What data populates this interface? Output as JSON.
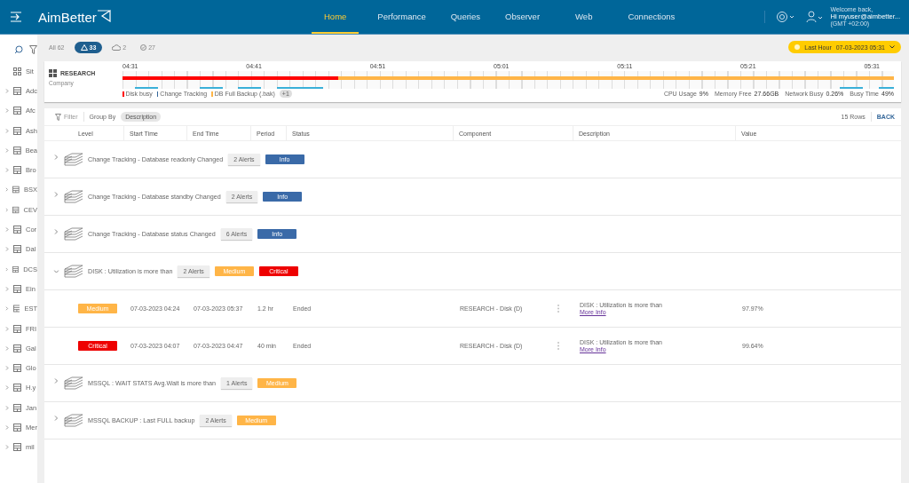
{
  "header": {
    "brand": "AimBetter",
    "nav": [
      {
        "label": "Home",
        "selected": true
      },
      {
        "label": "Performance",
        "selected": false
      },
      {
        "label": "Queries",
        "selected": false
      },
      {
        "label": "Observer",
        "selected": false
      },
      {
        "label": "Web",
        "selected": false
      },
      {
        "label": "Connections",
        "selected": false
      }
    ],
    "user": {
      "greeting": "Welcome back,",
      "name": "Hi myuser@aimbetter...",
      "timezone": "(GMT +02:00)"
    }
  },
  "sidebar": {
    "items": [
      {
        "label": "Sit",
        "kind": "group"
      },
      {
        "label": "Adc",
        "kind": "server"
      },
      {
        "label": "Afc",
        "kind": "server"
      },
      {
        "label": "Ash",
        "kind": "server"
      },
      {
        "label": "Bea",
        "kind": "server"
      },
      {
        "label": "Bro",
        "kind": "server"
      },
      {
        "label": "BSX",
        "kind": "server"
      },
      {
        "label": "CEV",
        "kind": "server"
      },
      {
        "label": "Cor",
        "kind": "server"
      },
      {
        "label": "Dal",
        "kind": "server"
      },
      {
        "label": "DCS",
        "kind": "server"
      },
      {
        "label": "Ein",
        "kind": "server"
      },
      {
        "label": "EST",
        "kind": "server"
      },
      {
        "label": "FRI",
        "kind": "server"
      },
      {
        "label": "Gal",
        "kind": "server"
      },
      {
        "label": "Glo",
        "kind": "server"
      },
      {
        "label": "H.y",
        "kind": "server"
      },
      {
        "label": "Jan",
        "kind": "server"
      },
      {
        "label": "Mer",
        "kind": "server"
      },
      {
        "label": "mil",
        "kind": "server"
      }
    ]
  },
  "filters": [
    {
      "label": "All 62",
      "kind": "all",
      "selected": false
    },
    {
      "label": "33",
      "kind": "alert",
      "selected": true
    },
    {
      "label": "2",
      "kind": "cloud",
      "selected": false
    },
    {
      "label": "27",
      "kind": "check",
      "selected": false
    }
  ],
  "time_range": {
    "label": "Last Hour",
    "value": "07-03-2023 05:31"
  },
  "server": {
    "name": "RESEARCH",
    "type": "Company",
    "ticks": [
      "04:31",
      "04:41",
      "04:51",
      "05:01",
      "05:11",
      "05:21",
      "05:31"
    ],
    "legend": [
      {
        "label": "Disk busy",
        "color": "#ff0000"
      },
      {
        "label": "Change Tracking",
        "color": "#336699"
      },
      {
        "label": "DB Full Backup (.bak)",
        "color": "#ffb547"
      }
    ],
    "more": "+1",
    "stats": [
      {
        "label": "CPU Usage",
        "value": "9%"
      },
      {
        "label": "Memory Free",
        "value": "27.66GB"
      },
      {
        "label": "Network Busy",
        "value": "0.26%"
      },
      {
        "label": "Busy Time",
        "value": "49%"
      }
    ]
  },
  "table": {
    "filter": "Filter",
    "group_by": "Group By",
    "group_value": "Description",
    "row_count": "15 Rows",
    "back": "BACK",
    "columns": [
      "Level",
      "Start Time",
      "End Time",
      "Period",
      "Status",
      "Component",
      "Description",
      "Value"
    ],
    "groups": [
      {
        "title": "Change Tracking - Database readonly Changed",
        "alerts": "2 Alerts",
        "expanded": false,
        "badges": [
          {
            "kind": "info",
            "label": "Info"
          }
        ]
      },
      {
        "title": "Change Tracking - Database standby Changed",
        "alerts": "2 Alerts",
        "expanded": false,
        "badges": [
          {
            "kind": "info",
            "label": "Info"
          }
        ]
      },
      {
        "title": "Change Tracking - Database status Changed",
        "alerts": "6 Alerts",
        "expanded": false,
        "badges": [
          {
            "kind": "info",
            "label": "Info"
          }
        ]
      },
      {
        "title": "DISK : Utilization is more than",
        "alerts": "2 Alerts",
        "expanded": true,
        "badges": [
          {
            "kind": "medium",
            "label": "Medium"
          },
          {
            "kind": "critical",
            "label": "Critical"
          }
        ],
        "rows": [
          {
            "level": {
              "kind": "medium",
              "label": "Medium"
            },
            "start": "07-03-2023 04:24",
            "end": "07-03-2023 05:37",
            "period": "1.2 hr",
            "status": "Ended",
            "component": "RESEARCH - Disk (D)",
            "description": "DISK : Utilization is more than",
            "link": "More Info",
            "value": "97.97%"
          },
          {
            "level": {
              "kind": "critical",
              "label": "Critical"
            },
            "start": "07-03-2023 04:07",
            "end": "07-03-2023 04:47",
            "period": "40 min",
            "status": "Ended",
            "component": "RESEARCH - Disk (D)",
            "description": "DISK : Utilization is more than",
            "link": "More Info",
            "value": "99.64%"
          }
        ]
      },
      {
        "title": "MSSQL : WAIT STATS Avg.Wait is more than",
        "alerts": "1 Alerts",
        "expanded": false,
        "badges": [
          {
            "kind": "medium",
            "label": "Medium"
          }
        ]
      },
      {
        "title": "MSSQL BACKUP : Last FULL backup",
        "alerts": "2 Alerts",
        "expanded": false,
        "badges": [
          {
            "kind": "medium",
            "label": "Medium"
          }
        ]
      }
    ]
  }
}
